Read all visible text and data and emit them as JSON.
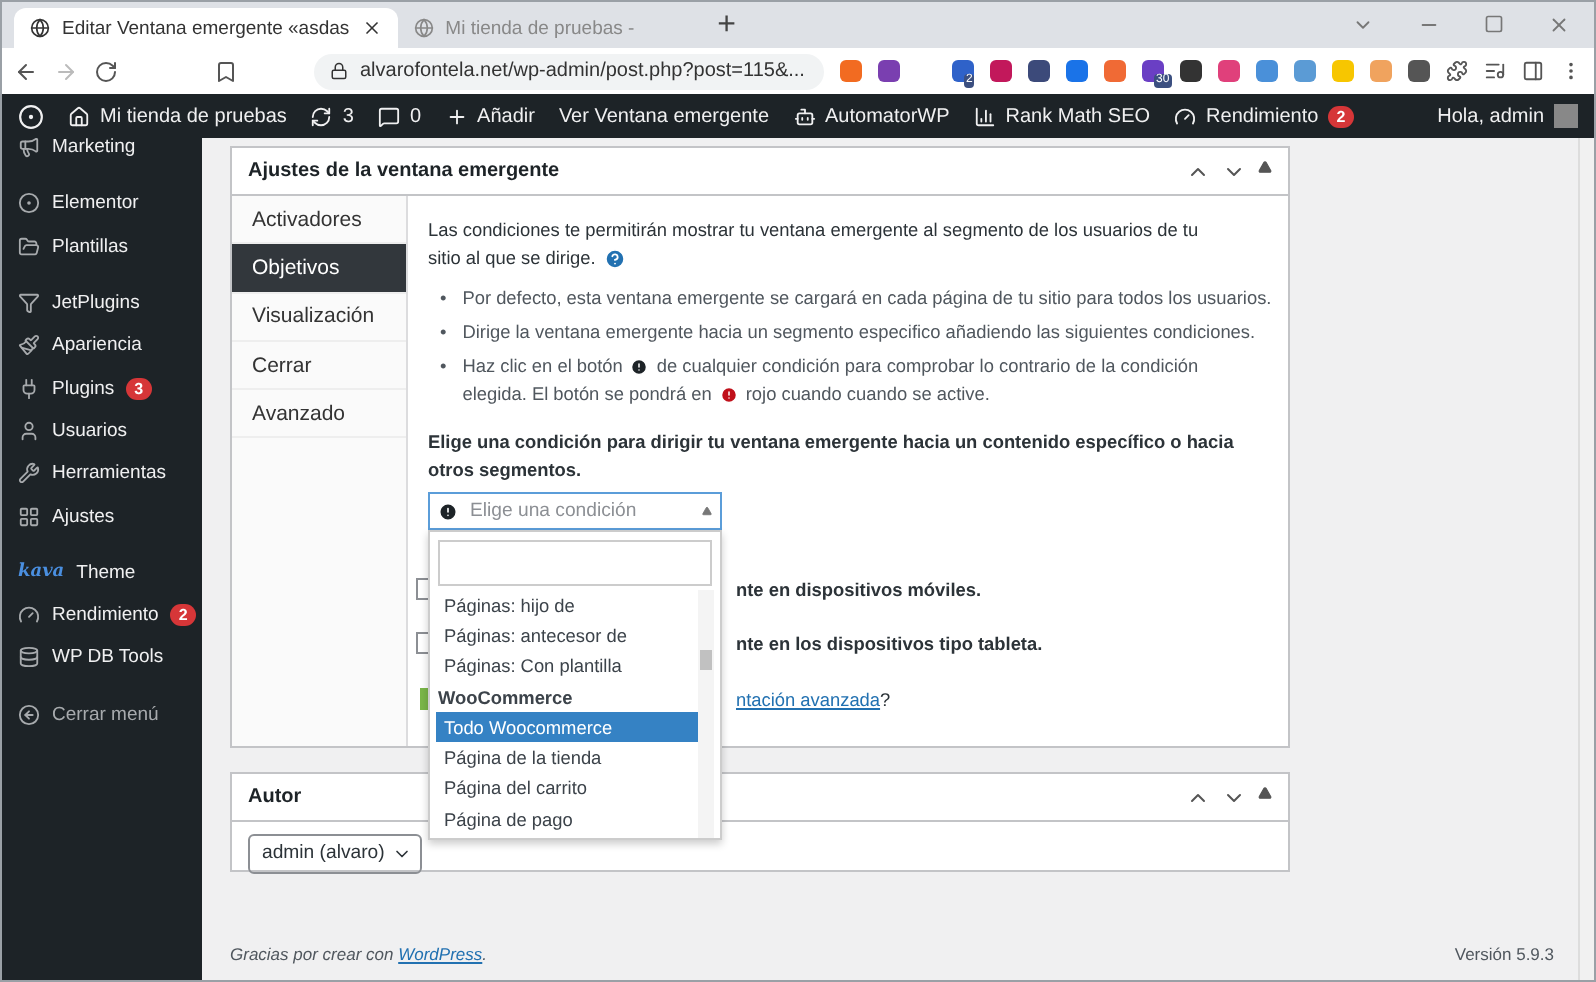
{
  "browser": {
    "tabs": [
      {
        "title": "Editar Ventana emergente «asdas",
        "selected": true
      },
      {
        "title": "Mi tienda de pruebas -",
        "selected": false
      }
    ],
    "new_tab": "+",
    "url": "alvarofontela.net/wp-admin/post.php?post=115&...",
    "extensions": [
      {
        "color": "#2f62c9",
        "badge": "2"
      },
      {
        "color": "#c2185b"
      },
      {
        "color": "#3c4a7a"
      },
      {
        "color": "#1a73e8"
      },
      {
        "color": "#f06a35"
      },
      {
        "color": "#6a3fc4",
        "badge": "30"
      },
      {
        "color": "#333333"
      },
      {
        "color": "#e0407b"
      },
      {
        "color": "#4a90d9"
      },
      {
        "color": "#5b9bd5"
      },
      {
        "color": "#f7c600"
      },
      {
        "color": "#f0a35e"
      },
      {
        "color": "#555555"
      }
    ]
  },
  "admin_bar": {
    "items": [
      {
        "label": "Mi tienda de pruebas"
      },
      {
        "label": "3"
      },
      {
        "label": "0"
      },
      {
        "label": "Añadir"
      },
      {
        "label": "Ver Ventana emergente"
      },
      {
        "label": "AutomatorWP"
      },
      {
        "label": "Rank Math SEO"
      },
      {
        "label": "Rendimiento",
        "badge": "2"
      }
    ],
    "greeting": "Hola, admin"
  },
  "sidebar": {
    "groups": [
      [
        {
          "label": "Marketing"
        }
      ],
      [
        {
          "label": "Elementor"
        },
        {
          "label": "Plantillas"
        }
      ],
      [
        {
          "label": "JetPlugins"
        },
        {
          "label": "Apariencia"
        },
        {
          "label": "Plugins",
          "badge": "3"
        },
        {
          "label": "Usuarios"
        },
        {
          "label": "Herramientas"
        },
        {
          "label": "Ajustes"
        }
      ],
      [
        {
          "label": "Theme",
          "logo_text": "kava"
        },
        {
          "label": "Rendimiento",
          "badge": "2"
        },
        {
          "label": "WP DB Tools"
        }
      ]
    ],
    "collapse": "Cerrar menú"
  },
  "popup_settings": {
    "title": "Ajustes de la ventana emergente",
    "tabs": [
      {
        "label": "Activadores",
        "selected": false
      },
      {
        "label": "Objetivos",
        "selected": true
      },
      {
        "label": "Visualización",
        "selected": false
      },
      {
        "label": "Cerrar",
        "selected": false
      },
      {
        "label": "Avanzado",
        "selected": false
      }
    ],
    "intro": [
      "Las condiciones te permitirán mostrar tu ventana emergente al segmento de los usuarios de tu",
      "sitio al que se dirige."
    ],
    "bullets": [
      {
        "marker": "•",
        "lines": [
          [
            {
              "kind": "text",
              "text": "Por defecto, esta ventana emergente se cargará en cada página de tu sitio para todos los usuarios."
            }
          ]
        ]
      },
      {
        "marker": "•",
        "lines": [
          [
            {
              "kind": "text",
              "text": "Dirige la ventana emergente hacia un segmento especifico añadiendo las siguientes condiciones."
            }
          ]
        ]
      },
      {
        "marker": "•",
        "lines": [
          [
            {
              "kind": "text",
              "text": "Haz clic en el botón"
            },
            {
              "kind": "icon",
              "color": "#1d2327"
            },
            {
              "kind": "text",
              "text": "de cualquier condición para comprobar lo contrario de la condición"
            }
          ],
          [
            {
              "kind": "text",
              "text": "elegida. El botón se pondrá en"
            },
            {
              "kind": "icon",
              "color": "#c0101a"
            },
            {
              "kind": "text",
              "text": "rojo cuando cuando se active."
            }
          ]
        ]
      }
    ],
    "condition_label": "Elige una condición para dirigir tu ventana emergente hacia un contenido específico o hacia otros segmentos.",
    "condition_select": {
      "placeholder": "Elige una condición",
      "expanded": true
    },
    "dropdown": {
      "options": [
        {
          "kind": "option",
          "label": "Páginas: hijo de",
          "selected": false
        },
        {
          "kind": "option",
          "label": "Páginas: antecesor de",
          "selected": false
        },
        {
          "kind": "option",
          "label": "Páginas: Con plantilla",
          "selected": false
        },
        {
          "kind": "group",
          "label": "WooCommerce",
          "selected": false
        },
        {
          "kind": "option",
          "label": "Todo Woocommerce",
          "selected": true
        },
        {
          "kind": "option",
          "label": "Página de la tienda",
          "selected": false
        },
        {
          "kind": "option",
          "label": "Página del carrito",
          "selected": false
        },
        {
          "kind": "option",
          "label": "Página de pago",
          "selected": false
        }
      ]
    },
    "device_rows": [
      {
        "text": "nte en dispositivos móviles.",
        "checked": false
      },
      {
        "text": "nte en los dispositivos tipo tableta.",
        "checked": false
      }
    ],
    "advanced": {
      "link": "ntación avanzada",
      "after": "?"
    }
  },
  "author_box": {
    "title": "Autor",
    "value": "admin (alvaro)"
  },
  "footer": {
    "before": "Gracias por crear con ",
    "link": "WordPress",
    "after": ".",
    "version": "Versión 5.9.3"
  }
}
